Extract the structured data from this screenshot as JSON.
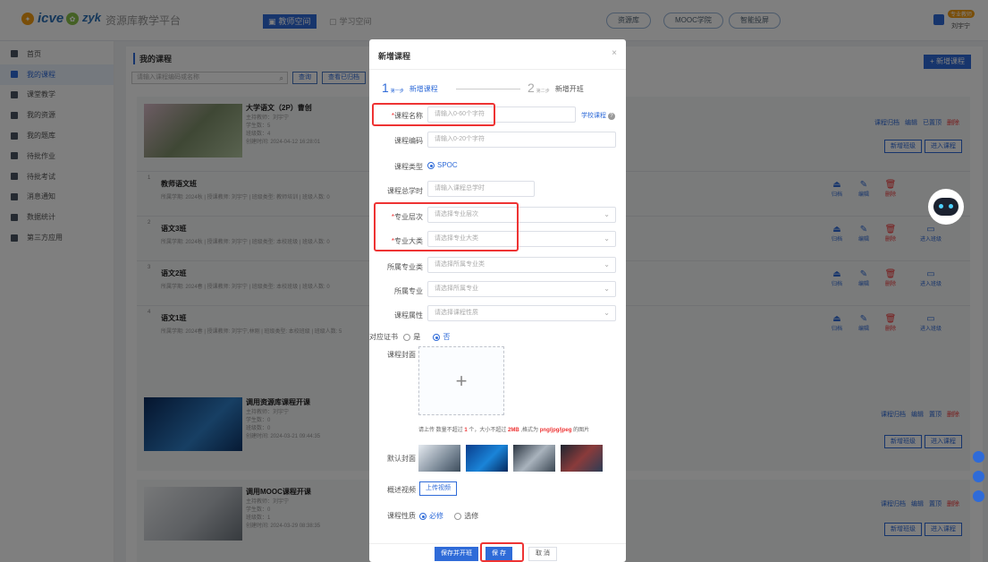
{
  "header": {
    "logo_text": "icve",
    "logo2_text": "zyk",
    "platform_name": "资源库教学平台",
    "space_teacher": "教师空间",
    "space_learn": "学习空间",
    "top_links": [
      "资源库",
      "MOOC学院",
      "智能投屏"
    ],
    "user_badge": "专业教师",
    "user_name": "刘宇宁"
  },
  "sidebar": {
    "items": [
      {
        "label": "首页"
      },
      {
        "label": "我的课程"
      },
      {
        "label": "课堂教学"
      },
      {
        "label": "我的资源"
      },
      {
        "label": "我的题库"
      },
      {
        "label": "待批作业"
      },
      {
        "label": "待批考试"
      },
      {
        "label": "消息通知"
      },
      {
        "label": "数据统计"
      },
      {
        "label": "第三方应用"
      }
    ]
  },
  "main": {
    "title": "我的课程",
    "search_placeholder": "请输入课程编码或名称",
    "search_btn": "查询",
    "archive_btn": "查看已归档",
    "new_course_btn": "+ 新增课程",
    "courses": [
      {
        "title": "大学语文（2P）曹创",
        "meta": [
          "主持教师：刘宇宁",
          "学生数：5",
          "班级数：4",
          "创建时间: 2024-04-12 16:28:01"
        ],
        "links": [
          "课程归档",
          "编辑",
          "已置顶",
          "删除"
        ],
        "buttons": [
          "新增班级",
          "进入课程"
        ]
      },
      {
        "title": "调用资源库课程开课",
        "meta": [
          "主持教师：刘宇宁",
          "学生数：0",
          "班级数：0",
          "创建时间: 2024-03-21 09:44:35"
        ],
        "links": [
          "课程归档",
          "编辑",
          "置顶",
          "删除"
        ],
        "buttons": [
          "新增班级",
          "进入课程"
        ]
      },
      {
        "title": "调用MOOC课程开课",
        "meta": [
          "主持教师：刘宇宁",
          "学生数：0",
          "班级数：1",
          "创建时间: 2024-03-29 08:38:35"
        ],
        "links": [
          "课程归档",
          "编辑",
          "置顶",
          "删除"
        ],
        "buttons": [
          "新增班级",
          "进入课程"
        ]
      }
    ],
    "classes": [
      {
        "num": "1",
        "name": "教师语文班",
        "info": "所属学期: 2024秋 | 授课教师: 刘宇宁 | 班级类型: 教师培训 | 班级人数: 0"
      },
      {
        "num": "2",
        "name": "语文3班",
        "info": "所属学期: 2024秋 | 授课教师: 刘宇宁 | 班级类型: 本校班级 | 班级人数: 0"
      },
      {
        "num": "3",
        "name": "语文2班",
        "info": "所属学期: 2024春 | 授课教师: 刘宇宁 | 班级类型: 本校班级 | 班级人数: 0"
      },
      {
        "num": "4",
        "name": "语文1班",
        "info": "所属学期: 2024春 | 授课教师: 刘宇宁,林刚 | 班级类型: 本校班级 | 班级人数: 5"
      }
    ],
    "class_actions": {
      "archive": "归档",
      "edit": "编辑",
      "delete": "删除",
      "enter": "进入班级"
    }
  },
  "modal": {
    "title": "新增课程",
    "step1_num": "1",
    "step1_sub": "第一步",
    "step1_label": "新增课程",
    "step2_num": "2",
    "step2_sub": "第二步",
    "step2_label": "新增开班",
    "fields": {
      "name_label": "课程名称",
      "name_placeholder": "请输入0-60个字符",
      "school_course": "学校课程",
      "code_label": "课程编码",
      "code_placeholder": "请输入0-20个字符",
      "type_label": "课程类型",
      "type_value": "SPOC",
      "hours_label": "课程总学时",
      "hours_placeholder": "请输入课程总学时",
      "level_label": "专业层次",
      "level_placeholder": "请选择专业层次",
      "category_label": "专业大类",
      "category_placeholder": "请选择专业大类",
      "subcat_label": "所属专业类",
      "subcat_placeholder": "请选择所属专业类",
      "major_label": "所属专业",
      "major_placeholder": "请选择所属专业",
      "attr_label": "课程属性",
      "attr_placeholder": "请选择课程性质",
      "cert_label": "对应证书",
      "cert_yes": "是",
      "cert_no": "否",
      "cover_label": "课程封面",
      "cover_tip_pre": "请上传 数量不超过",
      "cover_tip_count": "1",
      "cover_tip_mid": "个，大小不超过",
      "cover_tip_size": "2MB",
      "cover_tip_post": ",格式为",
      "cover_tip_fmt": "png/jpg/jpeg",
      "cover_tip_end": "的图片",
      "default_cover_label": "默认封面",
      "video_label": "概述视频",
      "video_btn": "上传视频",
      "nature_label": "课程性质",
      "nature_required": "必修",
      "nature_optional": "选修"
    },
    "footer": {
      "save_open": "保存并开班",
      "save": "保 存",
      "cancel": "取 消"
    }
  },
  "colors": {
    "primary": "#2f6bd8",
    "danger": "#e33333",
    "highlight": "#e33333"
  }
}
